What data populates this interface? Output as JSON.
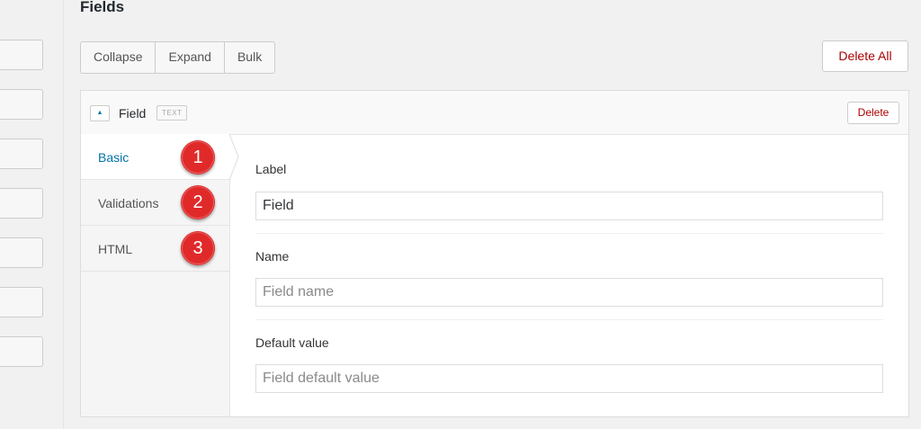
{
  "page": {
    "title": "Fields"
  },
  "toolbar": {
    "collapse": "Collapse",
    "expand": "Expand",
    "bulk": "Bulk",
    "delete_all": "Delete All"
  },
  "field": {
    "title": "Field",
    "type_badge": "TEXT",
    "delete": "Delete",
    "toggle_icon": "▲"
  },
  "tabs": [
    {
      "label": "Basic",
      "active": true,
      "badge": "1"
    },
    {
      "label": "Validations",
      "active": false,
      "badge": "2"
    },
    {
      "label": "HTML",
      "active": false,
      "badge": "3"
    }
  ],
  "form": {
    "label": {
      "label": "Label",
      "value": "Field",
      "placeholder": ""
    },
    "name": {
      "label": "Name",
      "value": "",
      "placeholder": "Field name"
    },
    "default": {
      "label": "Default value",
      "value": "",
      "placeholder": "Field default value"
    }
  },
  "colors": {
    "accent": "#0073aa",
    "danger": "#aa0000",
    "badge": "#e02a2a"
  }
}
